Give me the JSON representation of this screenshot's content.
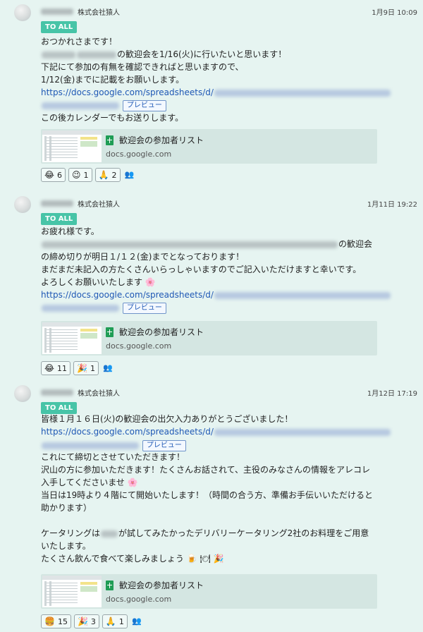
{
  "common": {
    "company": "株式会社猿人",
    "to_all": "TO ALL",
    "preview": "プレビュー",
    "card_title": "歓迎会の参加者リスト",
    "card_domain": "docs.google.com",
    "link_prefix": "https://docs.google.com/spreadsheets/d/"
  },
  "messages": [
    {
      "time": "1月9日 10:09",
      "lines": [
        "おつかれさまです！",
        "の歓迎会を1/16(火)に行いたいと思います！",
        "下記にて参加の有無を確認できればと思いますので、",
        "1/12(金)までに記載をお願いします。",
        "この後カレンダーでもお送りします。"
      ],
      "reactions": [
        {
          "icon": "😂",
          "count": "6"
        },
        {
          "icon": "😉",
          "count": "1"
        },
        {
          "icon": "🙏",
          "count": "2"
        }
      ]
    },
    {
      "time": "1月11日 19:22",
      "lines": [
        "お疲れ様です。",
        "の歓迎会",
        "の締め切りが明日１/１２(金)までとなっております！",
        "まだまだ未記入の方たくさんいらっしゃいますのでご記入いただけますと幸いです。",
        "よろしくお願いいたします",
        "🌸"
      ],
      "reactions": [
        {
          "icon": "😂",
          "count": "11"
        },
        {
          "icon": "🎉",
          "count": "1"
        }
      ]
    },
    {
      "time": "1月12日 17:19",
      "lines": [
        "皆様１月１６日(火)の歓迎会の出欠入力ありがとうございました！",
        "これにて締切とさせていただきます！",
        "沢山の方に参加いただきます！たくさんお話されて、主役のみなさんの情報をアレコレ",
        "入手してくださいませ",
        "🌸",
        "当日は19時より４階にて開始いたします！（時間の合う方、準備お手伝いいただけると",
        "助かります）",
        "ケータリングは",
        "が試してみたかったデリバリーケータリング2社のお料理をご用意",
        "いたします。",
        "たくさん飲んで食べて楽しみましょう",
        "🍺",
        "🍽",
        "🎉"
      ],
      "reactions": [
        {
          "icon": "🍔",
          "count": "15"
        },
        {
          "icon": "🎉",
          "count": "3"
        },
        {
          "icon": "🙏",
          "count": "1"
        }
      ]
    }
  ]
}
